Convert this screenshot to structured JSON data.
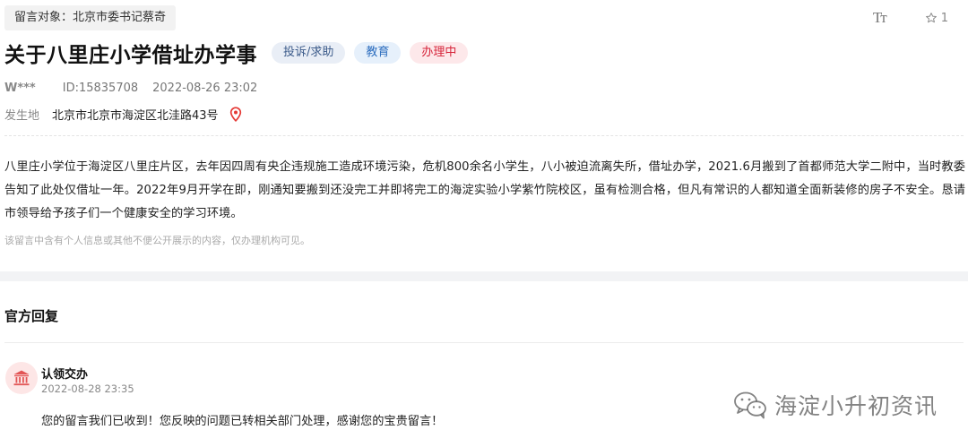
{
  "message": {
    "target": "留言对象：北京市委书记蔡奇",
    "title": "关于八里庄小学借址办学事",
    "tags": {
      "category": "投诉/求助",
      "field": "教育",
      "status": "办理中"
    },
    "author": "W***",
    "id": "ID:15835708",
    "datetime": "2022-08-26 23:02",
    "place_label": "发生地",
    "place_value": "北京市北京市海淀区北洼路43号",
    "content": "八里庄小学位于海淀区八里庄片区，去年因四周有央企违规施工造成环境污染，危机800余名小学生，八小被迫流离失所，借址办学，2021.6月搬到了首都师范大学二附中，当时教委告知了此处仅借址一年。2022年9月开学在即，刚通知要搬到还没完工并即将完工的海淀实验小学紫竹院校区，虽有检测合格，但凡有常识的人都知道全面新装修的房子不安全。恳请市领导给予孩子们一个健康安全的学习环境。",
    "privacy_note": "该留言中含有个人信息或其他不便公开展示的内容，仅办理机构可见。"
  },
  "tools": {
    "font_size_icon": "Tт",
    "favorite_count": "1",
    "favorite_icon": "star-outline-icon"
  },
  "reply": {
    "heading": "官方回复",
    "name": "认领交办",
    "time": "2022-08-28 23:35",
    "text": "您的留言我们已收到！您反映的问题已转相关部门处理，感谢您的宝贵留言！",
    "avatar_icon": "government-building-icon"
  },
  "watermark": {
    "text": "海淀小升初资讯",
    "icon": "wechat-icon"
  },
  "colors": {
    "status_red": "#d6243a",
    "field_blue": "#2f6fbf",
    "pin_red": "#e53935"
  }
}
